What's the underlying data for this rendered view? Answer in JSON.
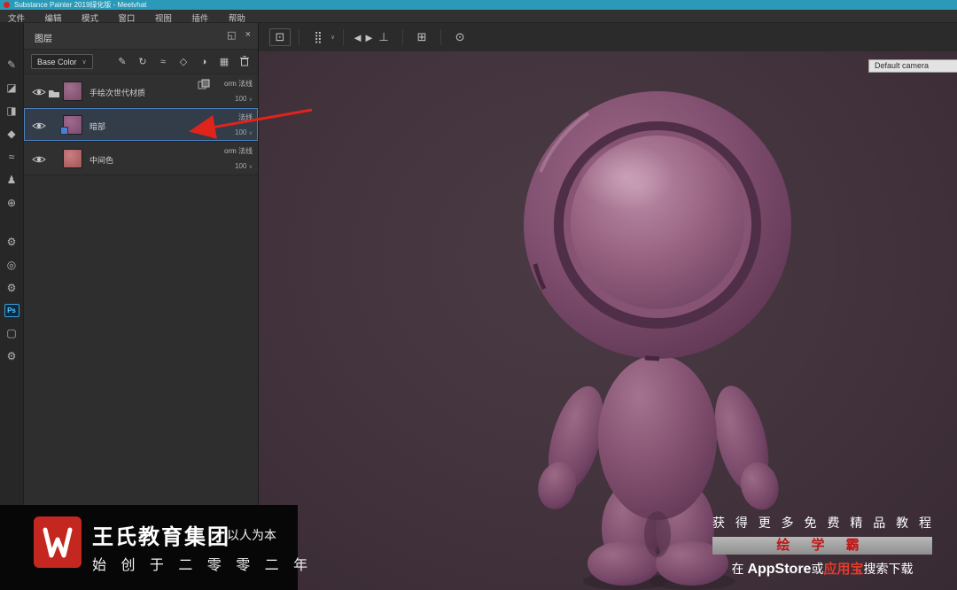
{
  "titlebar": {
    "title": "Substance Painter 2019绿化版 - Meetvhat"
  },
  "menubar": {
    "items": [
      "文件",
      "编辑",
      "模式",
      "窗口",
      "视图",
      "插件",
      "帮助"
    ]
  },
  "left_toolbar": {
    "tools": [
      "✎",
      "◪",
      "◨",
      "◆",
      "≈",
      "♟",
      "⊕"
    ],
    "settings": [
      "⚙",
      "◎",
      "⚙"
    ],
    "ps_label": "Ps",
    "extra": [
      "▢",
      "⚙"
    ]
  },
  "layers_panel": {
    "title": "图层",
    "dock_icon": "◱",
    "close_icon": "×",
    "channel": {
      "value": "Base Color",
      "caret": "∨"
    },
    "toolbar_icons": [
      "✎",
      "↻",
      "≈",
      "◇",
      "◑",
      "▦"
    ],
    "layers": [
      {
        "name": "手绘次世代材质",
        "blend": "orm 法线",
        "opacity": "100",
        "caret": "∨"
      },
      {
        "name": "暗部",
        "blend": "法线",
        "opacity": "100",
        "caret": "∨"
      },
      {
        "name": "中间色",
        "blend": "orm 法线",
        "opacity": "100",
        "caret": "∨"
      }
    ]
  },
  "viewport": {
    "toolbar_icons": [
      "⊡",
      "⣿",
      "◄►",
      "⊥",
      "⊞",
      "⊙"
    ],
    "toolbar_caret": "∨",
    "camera_label": "Default camera"
  },
  "watermarks": {
    "left": {
      "brand": "王氏教育集团",
      "tagline": "以人为本",
      "line2": "始 创 于 二 零 零 二 年"
    },
    "right": {
      "line1": "获 得 更 多 免 费 精 品 教 程",
      "banner": "绘 学 霸",
      "line3_pre": "在",
      "line3_appstore": "AppStore",
      "line3_or": "或",
      "line3_store": "应用宝",
      "line3_post": "搜索下载"
    }
  },
  "colors": {
    "selection_blue": "#4d80c0",
    "annotation_red": "#e0241b",
    "model_base": "#8a5574",
    "titlebar_teal": "#2a9ab8"
  }
}
